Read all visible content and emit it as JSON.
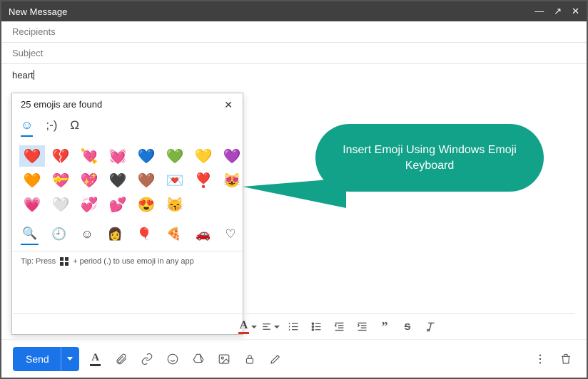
{
  "window": {
    "title": "New Message"
  },
  "fields": {
    "recipients_placeholder": "Recipients",
    "subject_placeholder": "Subject",
    "body_text": "heart"
  },
  "emoji_panel": {
    "status": "25 emojis are found",
    "tabs": {
      "emoji": "☺",
      "kaomoji": ";-)",
      "symbols": "Ω"
    },
    "emojis": [
      "❤️",
      "💔",
      "💘",
      "💓",
      "💙",
      "💚",
      "💛",
      "💜",
      "🧡",
      "💝",
      "💖",
      "🖤",
      "🤎",
      "💌",
      "❣️",
      "😻",
      "💗",
      "🤍",
      "💞",
      "💕",
      "😍",
      "😽"
    ],
    "categories": {
      "search": "🔍",
      "recent": "🕘",
      "faces": "☺",
      "people": "👩",
      "celebration": "🎈",
      "food": "🍕",
      "transport": "🚗",
      "heart": "♡"
    },
    "tip_pre": "Tip: Press",
    "tip_post": "+ period (.) to use emoji in any app"
  },
  "callout": {
    "text": "Insert Emoji Using Windows Emoji Keyboard"
  },
  "toolbar": {
    "send_label": "Send"
  }
}
